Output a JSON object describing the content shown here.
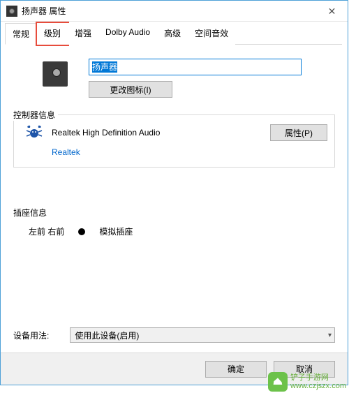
{
  "title": "扬声器 属性",
  "tabs": [
    "常规",
    "级别",
    "增强",
    "Dolby Audio",
    "高级",
    "空间音效"
  ],
  "active_tab_index": 0,
  "highlighted_tab_index": 1,
  "device_name": "扬声器",
  "change_icon_label": "更改图标(I)",
  "controller": {
    "legend": "控制器信息",
    "name": "Realtek High Definition Audio",
    "properties_btn": "属性(P)",
    "vendor": "Realtek"
  },
  "jack": {
    "legend": "插座信息",
    "position": "左前 右前",
    "type": "模拟插座"
  },
  "usage": {
    "label": "设备用法:",
    "selected": "使用此设备(启用)"
  },
  "footer": {
    "ok": "确定",
    "cancel": "取消"
  },
  "watermark": {
    "line1": "铲子手游网",
    "line2": "www.czjszx.com"
  }
}
